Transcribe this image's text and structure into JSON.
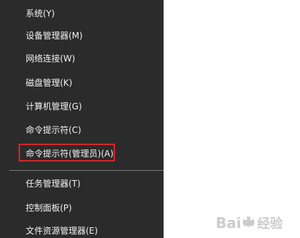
{
  "menu": {
    "items": [
      {
        "label": "系统(Y)"
      },
      {
        "label": "设备管理器(M)"
      },
      {
        "label": "网络连接(W)"
      },
      {
        "label": "磁盘管理(K)"
      },
      {
        "label": "计算机管理(G)"
      },
      {
        "label": "命令提示符(C)"
      },
      {
        "label": "命令提示符(管理员)(A)"
      },
      {
        "label": "任务管理器(T)"
      },
      {
        "label": "控制面板(P)"
      },
      {
        "label": "文件资源管理器(E)"
      }
    ]
  },
  "colors": {
    "menu_bg": "#2b2b2b",
    "menu_text": "#f2f2f2",
    "highlight": "#d3272b",
    "separator": "#7a7a7a"
  },
  "watermark": {
    "text": "Baidu 经验"
  }
}
